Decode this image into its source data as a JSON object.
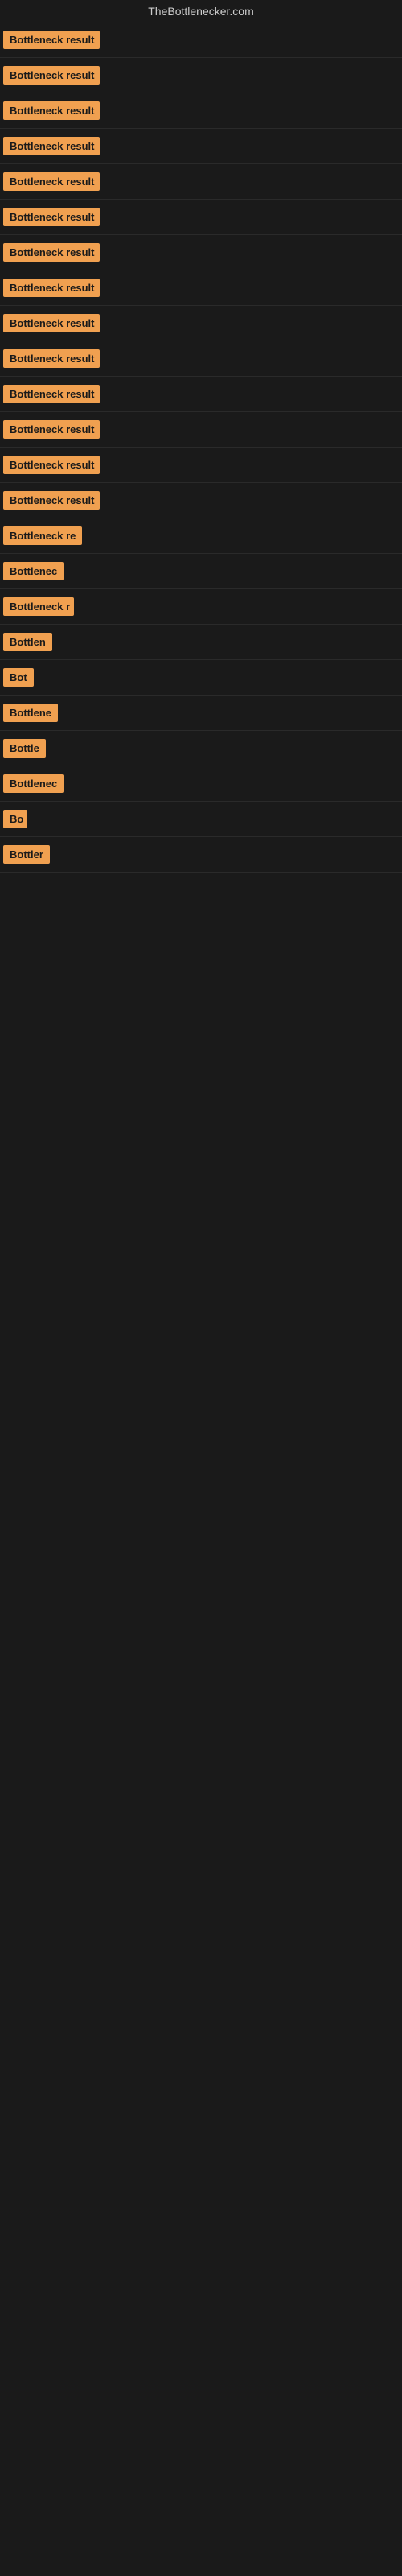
{
  "site": {
    "title": "TheBottlenecker.com"
  },
  "items": [
    {
      "id": 1,
      "label": "Bottleneck result",
      "width": 120
    },
    {
      "id": 2,
      "label": "Bottleneck result",
      "width": 120
    },
    {
      "id": 3,
      "label": "Bottleneck result",
      "width": 120
    },
    {
      "id": 4,
      "label": "Bottleneck result",
      "width": 120
    },
    {
      "id": 5,
      "label": "Bottleneck result",
      "width": 120
    },
    {
      "id": 6,
      "label": "Bottleneck result",
      "width": 120
    },
    {
      "id": 7,
      "label": "Bottleneck result",
      "width": 120
    },
    {
      "id": 8,
      "label": "Bottleneck result",
      "width": 120
    },
    {
      "id": 9,
      "label": "Bottleneck result",
      "width": 120
    },
    {
      "id": 10,
      "label": "Bottleneck result",
      "width": 120
    },
    {
      "id": 11,
      "label": "Bottleneck result",
      "width": 120
    },
    {
      "id": 12,
      "label": "Bottleneck result",
      "width": 120
    },
    {
      "id": 13,
      "label": "Bottleneck result",
      "width": 120
    },
    {
      "id": 14,
      "label": "Bottleneck result",
      "width": 120
    },
    {
      "id": 15,
      "label": "Bottleneck re",
      "width": 100
    },
    {
      "id": 16,
      "label": "Bottlenec",
      "width": 80
    },
    {
      "id": 17,
      "label": "Bottleneck r",
      "width": 88
    },
    {
      "id": 18,
      "label": "Bottlen",
      "width": 68
    },
    {
      "id": 19,
      "label": "Bot",
      "width": 40
    },
    {
      "id": 20,
      "label": "Bottlene",
      "width": 72
    },
    {
      "id": 21,
      "label": "Bottle",
      "width": 60
    },
    {
      "id": 22,
      "label": "Bottlenec",
      "width": 80
    },
    {
      "id": 23,
      "label": "Bo",
      "width": 30
    },
    {
      "id": 24,
      "label": "Bottler",
      "width": 62
    }
  ]
}
